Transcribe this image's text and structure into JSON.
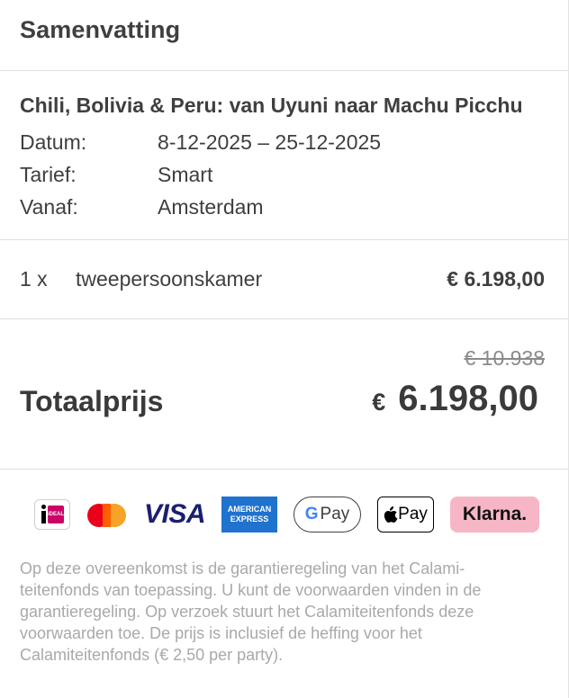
{
  "header": {
    "title": "Samenvatting"
  },
  "trip": {
    "title": "Chili, Bolivia & Peru: van Uyuni naar Machu Picchu",
    "rows": [
      {
        "label": "Datum:",
        "value": "8-12-2025 – 25-12-2025"
      },
      {
        "label": "Tarief:",
        "value": "Smart"
      },
      {
        "label": "Vanaf:",
        "value": "Amsterdam"
      }
    ]
  },
  "line_item": {
    "qty": "1 x",
    "description": "tweepersoonskamer",
    "price": "€ 6.198,00"
  },
  "total": {
    "old_price": "€ 10.938",
    "label": "Totaalprijs",
    "currency": "€",
    "amount": "6.198,00"
  },
  "payments": [
    {
      "name": "iDEAL",
      "icon": "ideal-icon",
      "text": "iDEAL"
    },
    {
      "name": "Mastercard",
      "icon": "mastercard-icon"
    },
    {
      "name": "Visa",
      "icon": "visa-icon",
      "text": "VISA"
    },
    {
      "name": "American Express",
      "icon": "amex-icon",
      "text_line1": "AMERICAN",
      "text_line2": "EXPRESS"
    },
    {
      "name": "Google Pay",
      "icon": "google-pay-icon",
      "text_g": "G",
      "text": "Pay"
    },
    {
      "name": "Apple Pay",
      "icon": "apple-pay-icon",
      "text": "Pay"
    },
    {
      "name": "Klarna",
      "icon": "klarna-icon",
      "text": "Klarna."
    }
  ],
  "disclaimer": "Op deze overeenkomst is de garantieregeling van het Calami-teitenfonds van toepassing. U kunt de voorwaarden vinden in de garantieregeling. Op verzoek stuurt het Calamiteitenfonds deze voorwaarden toe. De prijs is inclusief de heffing voor het Calamiteitenfonds (€ 2,50 per party).",
  "colors": {
    "text": "#3f3f3f",
    "muted": "#a9a9a9",
    "divider": "#e0e0e0",
    "visa": "#1a1f71",
    "amex": "#1f72cd",
    "klarna": "#f7b6c6",
    "ideal": "#cc0066"
  }
}
